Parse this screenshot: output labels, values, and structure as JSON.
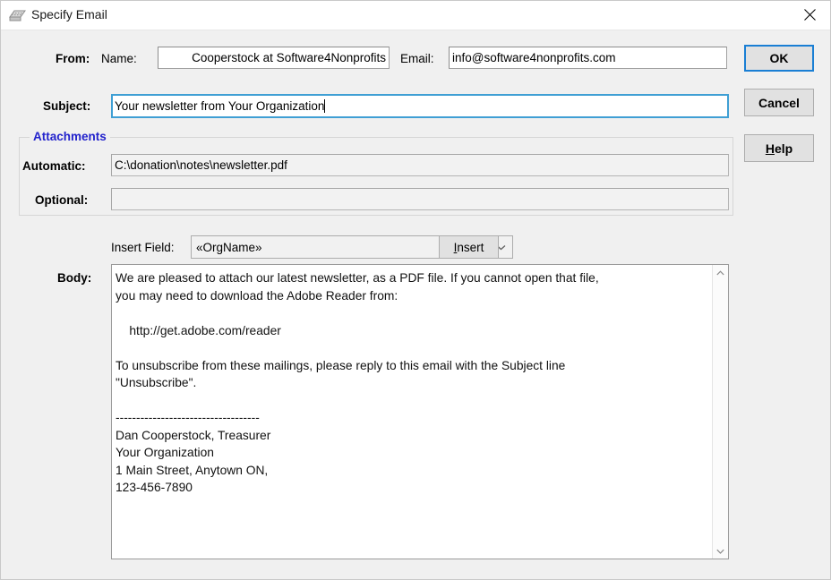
{
  "window": {
    "title": "Specify Email",
    "icon": "email-card-icon",
    "close_icon": "close-icon"
  },
  "form": {
    "from_label": "From:",
    "name_label": "Name:",
    "name_value": "Cooperstock at Software4Nonprofits",
    "email_label": "Email:",
    "email_value": "info@software4nonprofits.com",
    "subject_label": "Subject:",
    "subject_value": "Your newsletter from Your Organization",
    "body_label": "Body:"
  },
  "attachments": {
    "legend": "Attachments",
    "automatic_label": "Automatic:",
    "automatic_value": "C:\\donation\\notes\\newsletter.pdf",
    "optional_label": "Optional:",
    "optional_value": ""
  },
  "insert_field": {
    "label": "Insert Field:",
    "selected": "«OrgName»",
    "arrow_icon": "chevron-down-icon",
    "button_accel": "I",
    "button_rest": "nsert"
  },
  "body": {
    "text": "We are pleased to attach our latest newsletter, as a PDF file. If you cannot open that file,\nyou may need to download the Adobe Reader from:\n\n    http://get.adobe.com/reader\n\nTo unsubscribe from these mailings, please reply to this email with the Subject line\n\"Unsubscribe\".\n\n-----------------------------------\nDan Cooperstock, Treasurer\nYour Organization\n1 Main Street, Anytown ON,\n123-456-7890",
    "scroll_up_icon": "chevron-up-icon",
    "scroll_down_icon": "chevron-down-icon"
  },
  "buttons": {
    "ok": "OK",
    "cancel": "Cancel",
    "help_accel": "H",
    "help_rest": "elp"
  },
  "colors": {
    "dialog_bg": "#f0f0f0",
    "group_legend": "#2222cc",
    "focus_blue": "#1a7fd4",
    "field_bg": "#ffffff",
    "readonly_bg": "#f2f2f2"
  }
}
